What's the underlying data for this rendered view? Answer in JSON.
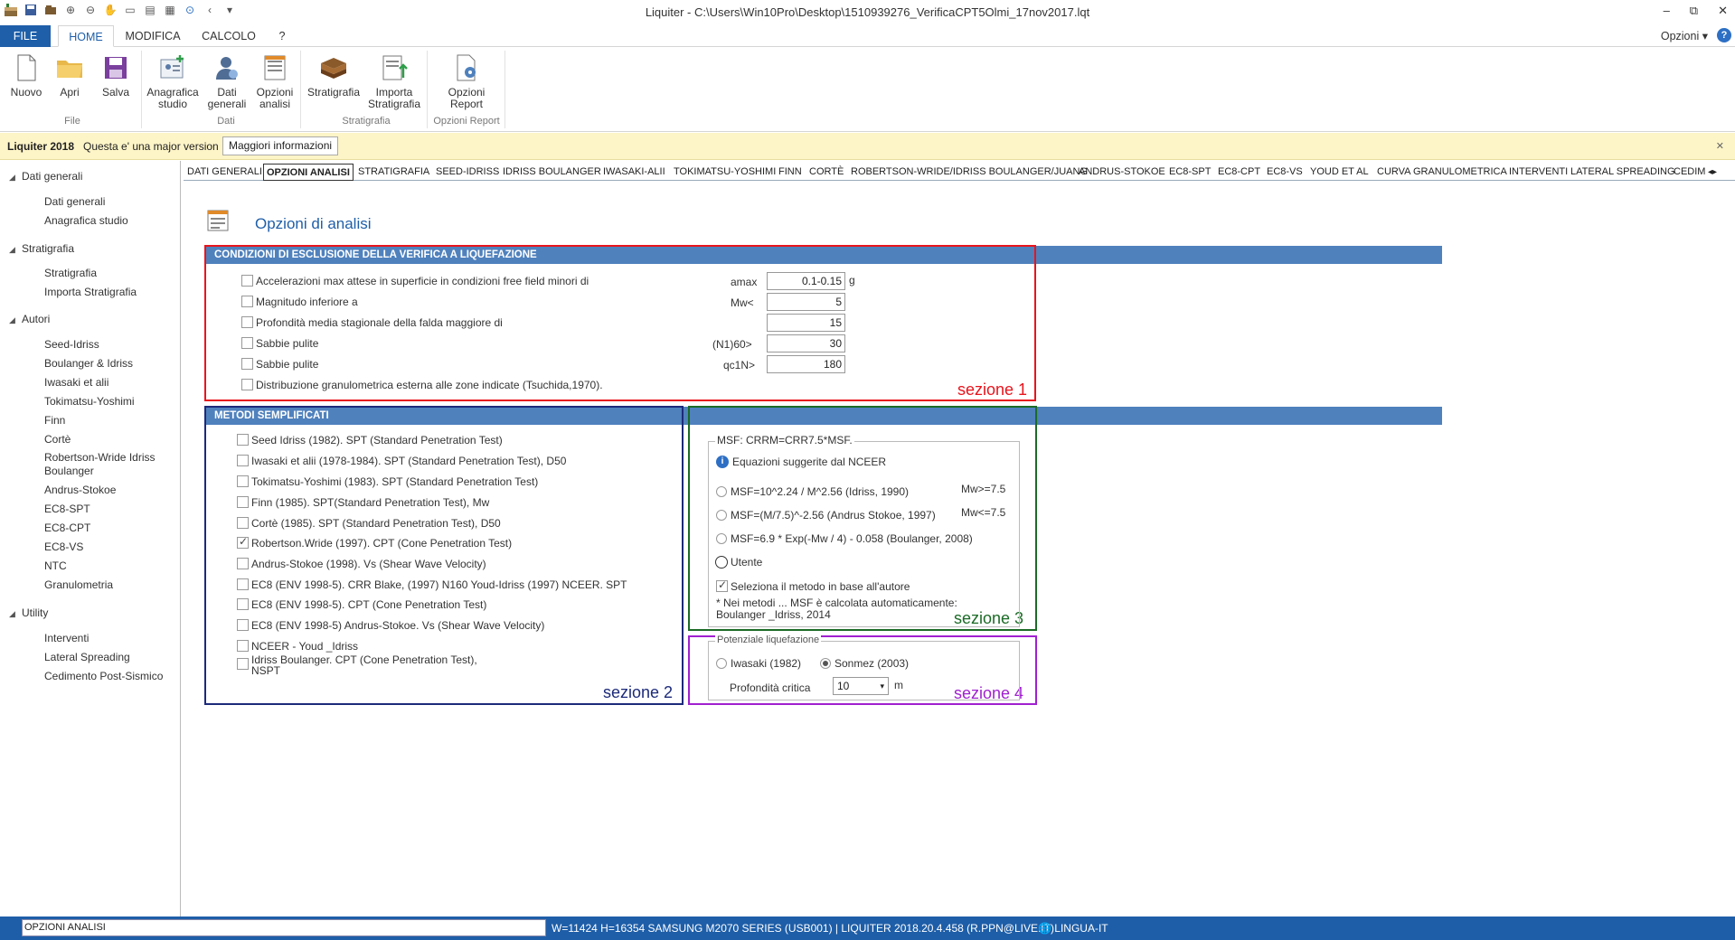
{
  "window": {
    "title": "Liquiter - C:\\Users\\Win10Pro\\Desktop\\1510939276_VerificaCPT5Olmi_17nov2017.lqt",
    "controls": [
      "–",
      "⧉",
      "✕"
    ]
  },
  "ribbon_tabs": {
    "file": "FILE",
    "home": "HOME",
    "modifica": "MODIFICA",
    "calcolo": "CALCOLO",
    "help": "?"
  },
  "opzioni_menu": "Opzioni ▾",
  "ribbon": {
    "nuovo": "Nuovo",
    "apri": "Apri",
    "salva": "Salva",
    "anagrafica": "Anagrafica studio",
    "dati_generali": "Dati generali",
    "opzioni_analisi": "Opzioni analisi",
    "stratigrafia": "Stratigrafia",
    "importa": "Importa Stratigrafia",
    "opzioni_report": "Opzioni Report",
    "group_file": "File",
    "group_dati": "Dati",
    "group_strat": "Stratigrafia",
    "group_report": "Opzioni Report"
  },
  "infobar": {
    "app": "Liquiter 2018",
    "text": "Questa e' una major version",
    "button": "Maggiori informazioni",
    "close": "✕"
  },
  "nav": {
    "dati_generali": "Dati generali",
    "dati_generali_items": [
      "Dati generali",
      "Anagrafica studio"
    ],
    "stratigrafia": "Stratigrafia",
    "stratigrafia_items": [
      "Stratigrafia",
      "Importa Stratigrafia"
    ],
    "autori": "Autori",
    "autori_items": [
      "Seed-Idriss",
      "Boulanger & Idriss",
      "Iwasaki et alii",
      "Tokimatsu-Yoshimi",
      "Finn",
      "Cortè",
      "Robertson-Wride Idriss",
      "Boulanger",
      "Andrus-Stokoe",
      "EC8-SPT",
      "EC8-CPT",
      "EC8-VS",
      "NTC",
      "Granulometria"
    ],
    "utility": "Utility",
    "utility_items": [
      "Interventi",
      "Lateral Spreading",
      "Cedimento Post-Sismico"
    ]
  },
  "content_tabs": [
    "DATI GENERALI",
    "OPZIONI ANALISI",
    "STRATIGRAFIA",
    "SEED-IDRISS",
    "IDRISS BOULANGER",
    "IWASAKI-ALII",
    "TOKIMATSU-YOSHIMI",
    "FINN",
    "CORTÈ",
    "ROBERTSON-WRIDE/IDRISS BOULANGER/JUANG",
    "ANDRUS-STOKOE",
    "EC8-SPT",
    "EC8-CPT",
    "EC8-VS",
    "YOUD ET AL",
    "CURVA GRANULOMETRICA",
    "INTERVENTI",
    "LATERAL SPREADING",
    "CEDIMEI"
  ],
  "page_title": "Opzioni di analisi",
  "sec1": {
    "header": "CONDIZIONI DI ESCLUSIONE DELLA VERIFICA A LIQUEFAZIONE",
    "label": "sezione 1",
    "rows": [
      {
        "text": "Accelerazioni max attese in superficie in condizioni free field minori di",
        "param": "amax",
        "value": "0.1-0.15",
        "unit": "g"
      },
      {
        "text": "Magnitudo inferiore a",
        "param": "Mw<",
        "value": "5",
        "unit": ""
      },
      {
        "text": "Profondità media stagionale della falda maggiore di",
        "param": "",
        "value": "15",
        "unit": ""
      },
      {
        "text": "Sabbie pulite",
        "param": "(N1)60>",
        "value": "30",
        "unit": ""
      },
      {
        "text": "Sabbie pulite",
        "param": "qc1N>",
        "value": "180",
        "unit": ""
      },
      {
        "text": "Distribuzione granulometrica esterna alle zone indicate (Tsuchida,1970).",
        "param": "",
        "value": "",
        "unit": ""
      }
    ]
  },
  "sec2": {
    "header": "METODI SEMPLIFICATI",
    "label": "sezione 2",
    "methods": [
      "Seed Idriss (1982). SPT (Standard Penetration Test)",
      "Iwasaki et alii (1978-1984). SPT (Standard Penetration Test), D50",
      "Tokimatsu-Yoshimi (1983). SPT (Standard Penetration Test)",
      "Finn (1985). SPT(Standard Penetration Test), Mw",
      "Cortè (1985). SPT (Standard Penetration Test), D50",
      "Robertson.Wride (1997). CPT (Cone Penetration Test)",
      "Andrus-Stokoe (1998). Vs (Shear Wave Velocity)",
      "EC8 (ENV 1998-5). CRR Blake, (1997) N160 Youd-Idriss (1997) NCEER. SPT",
      "EC8 (ENV 1998-5). CPT (Cone Penetration Test)",
      "EC8 (ENV 1998-5) Andrus-Stokoe. Vs (Shear Wave Velocity)",
      "NCEER - Youd _Idriss",
      "Idriss Boulanger. CPT (Cone Penetration Test),",
      "NSPT"
    ]
  },
  "sec3": {
    "label": "sezione 3",
    "group_title": "MSF: CRRM=CRR7.5*MSF.",
    "info": "Equazioni suggerite dal NCEER",
    "opt1": "MSF=10^2.24 / M^2.56 (Idriss, 1990)",
    "opt1_cond": "Mw>=7.5",
    "opt2": "MSF=(M/7.5)^-2.56 (Andrus Stokoe, 1997)",
    "opt2_cond": "Mw<=7.5",
    "opt3": "MSF=6.9 * Exp(-Mw / 4) - 0.058 (Boulanger, 2008)",
    "utente": "Utente",
    "auto_check": "Seleziona il metodo in base all'autore",
    "note1": "* Nei metodi ... MSF è calcolata automaticamente:",
    "note2": "Boulanger _Idriss, 2014"
  },
  "sec4": {
    "label": "sezione 4",
    "group_title": "Potenziale liquefazione",
    "opt1": "Iwasaki (1982)",
    "opt2": "Sonmez (2003)",
    "depth_label": "Profondità critica",
    "depth_value": "10",
    "unit": "m"
  },
  "statusbar": {
    "input": "OPZIONI ANALISI",
    "info": "W=11424 H=16354 SAMSUNG M2070 SERIES (USB001) |    LIQUITER 2018.20.4.458 (R.PPN@LIVE.IT)",
    "lang": "LINGUA-IT"
  },
  "colors": {
    "accent": "#1f5fa9",
    "section_bar": "#4f81bd",
    "sec1": "#e8141c",
    "sec2": "#1c2a7a",
    "sec3": "#1b6b26",
    "sec4": "#a020d0"
  }
}
